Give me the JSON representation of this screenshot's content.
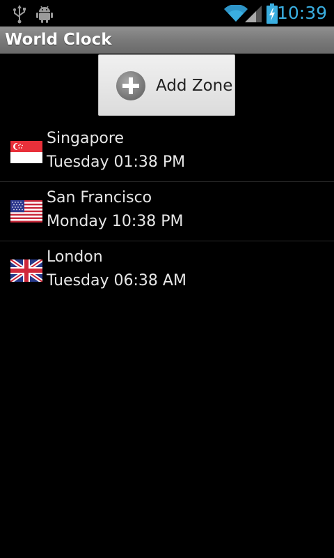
{
  "status_bar": {
    "clock": "10:39",
    "icons": [
      "usb-icon",
      "android-debug-icon",
      "wifi-icon",
      "signal-icon",
      "battery-charging-icon"
    ],
    "accent_color": "#3aaee0"
  },
  "app": {
    "title": "World Clock"
  },
  "add_zone": {
    "label": "Add Zone",
    "icon": "plus-circle-icon"
  },
  "zones": [
    {
      "city": "Singapore",
      "time": "Tuesday 01:38 PM",
      "flag": "singapore-flag-icon"
    },
    {
      "city": "San Francisco",
      "time": "Monday 10:38 PM",
      "flag": "usa-flag-icon"
    },
    {
      "city": "London",
      "time": "Tuesday 06:38 AM",
      "flag": "uk-flag-icon"
    }
  ]
}
